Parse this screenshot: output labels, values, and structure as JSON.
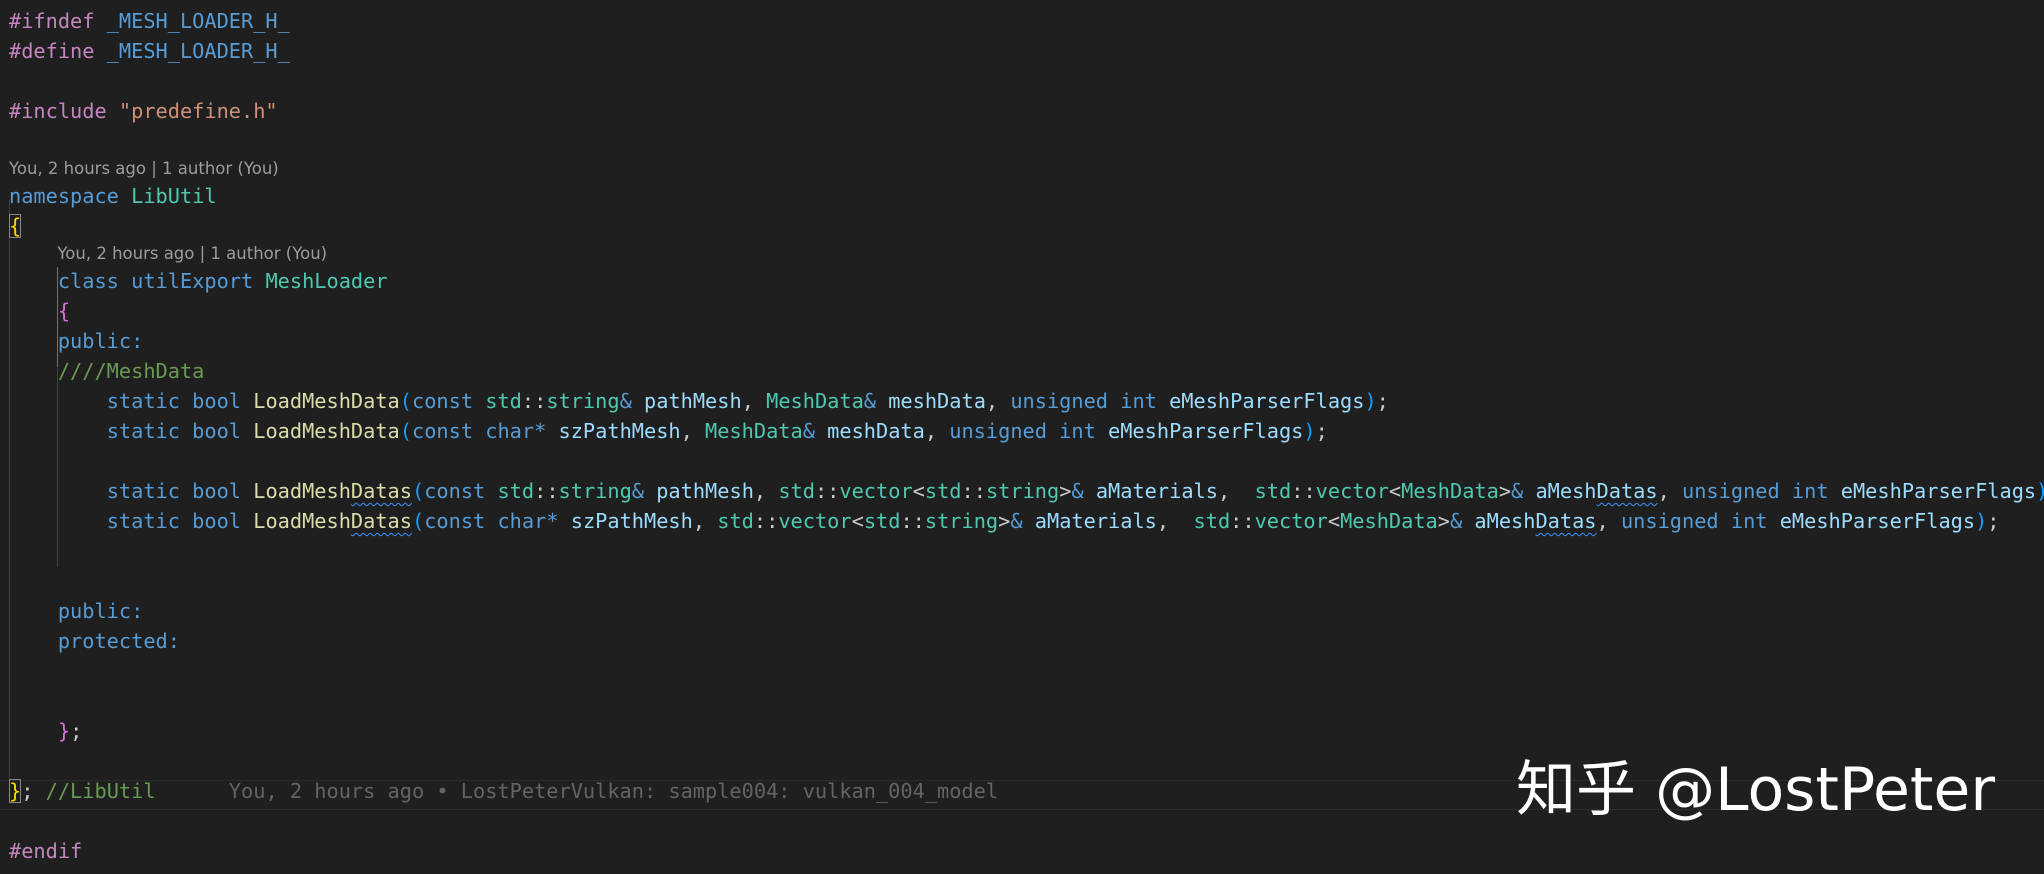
{
  "editor": {
    "theme_colors": {
      "background": "#1f1f1f",
      "preprocessor": "#c586c0",
      "keyword": "#569cd6",
      "type": "#4ec9b0",
      "function": "#dcdcaa",
      "parameter": "#9cdcfe",
      "string": "#ce9178",
      "comment": "#6a9955",
      "codelens": "#9d9d9d",
      "inline_blame": "#646464"
    },
    "lines": [
      {
        "kind": "code",
        "tokens": [
          {
            "t": "#ifndef ",
            "c": "pp"
          },
          {
            "t": "_MESH_LOADER_H_",
            "c": "macro"
          }
        ]
      },
      {
        "kind": "code",
        "tokens": [
          {
            "t": "#define ",
            "c": "pp"
          },
          {
            "t": "_MESH_LOADER_H_",
            "c": "macro"
          }
        ]
      },
      {
        "kind": "blank"
      },
      {
        "kind": "code",
        "tokens": [
          {
            "t": "#include ",
            "c": "pp"
          },
          {
            "t": "\"predefine.h\"",
            "c": "str"
          }
        ]
      },
      {
        "kind": "blank"
      },
      {
        "kind": "lens",
        "text": "You, 2 hours ago | 1 author (You)",
        "indent": 0
      },
      {
        "kind": "code",
        "tokens": [
          {
            "t": "namespace ",
            "c": "kw"
          },
          {
            "t": "LibUtil",
            "c": "type"
          }
        ]
      },
      {
        "kind": "code",
        "tokens": [
          {
            "t": "{",
            "c": "brace-y",
            "box": true
          }
        ]
      },
      {
        "kind": "lens",
        "text": "You, 2 hours ago | 1 author (You)",
        "indent": 4
      },
      {
        "kind": "code",
        "tokens": [
          {
            "t": "    "
          },
          {
            "t": "class ",
            "c": "kw"
          },
          {
            "t": "utilExport ",
            "c": "kw"
          },
          {
            "t": "MeshLoader",
            "c": "type"
          }
        ]
      },
      {
        "kind": "code",
        "tokens": [
          {
            "t": "    "
          },
          {
            "t": "{",
            "c": "brace"
          }
        ]
      },
      {
        "kind": "code",
        "tokens": [
          {
            "t": "    "
          },
          {
            "t": "public:",
            "c": "kw"
          }
        ]
      },
      {
        "kind": "code",
        "tokens": [
          {
            "t": "    "
          },
          {
            "t": "////MeshData",
            "c": "comment"
          }
        ]
      },
      {
        "kind": "code",
        "tokens": [
          {
            "t": "        "
          },
          {
            "t": "static ",
            "c": "kw"
          },
          {
            "t": "bool ",
            "c": "kw"
          },
          {
            "t": "LoadMeshData",
            "c": "fn"
          },
          {
            "t": "(",
            "c": "paren"
          },
          {
            "t": "const ",
            "c": "kw"
          },
          {
            "t": "std",
            "c": "type"
          },
          {
            "t": "::",
            "c": "punct"
          },
          {
            "t": "string",
            "c": "type"
          },
          {
            "t": "& ",
            "c": "kw"
          },
          {
            "t": "pathMesh",
            "c": "param"
          },
          {
            "t": ", ",
            "c": "punct"
          },
          {
            "t": "MeshData",
            "c": "type"
          },
          {
            "t": "& ",
            "c": "kw"
          },
          {
            "t": "meshData",
            "c": "param"
          },
          {
            "t": ", ",
            "c": "punct"
          },
          {
            "t": "unsigned ",
            "c": "kw"
          },
          {
            "t": "int ",
            "c": "kw"
          },
          {
            "t": "eMeshParserFlags",
            "c": "param"
          },
          {
            "t": ")",
            "c": "paren"
          },
          {
            "t": ";",
            "c": "punct"
          }
        ]
      },
      {
        "kind": "code",
        "tokens": [
          {
            "t": "        "
          },
          {
            "t": "static ",
            "c": "kw"
          },
          {
            "t": "bool ",
            "c": "kw"
          },
          {
            "t": "LoadMeshData",
            "c": "fn"
          },
          {
            "t": "(",
            "c": "paren"
          },
          {
            "t": "const ",
            "c": "kw"
          },
          {
            "t": "char",
            "c": "kw"
          },
          {
            "t": "* ",
            "c": "kw"
          },
          {
            "t": "szPathMesh",
            "c": "param"
          },
          {
            "t": ", ",
            "c": "punct"
          },
          {
            "t": "MeshData",
            "c": "type"
          },
          {
            "t": "& ",
            "c": "kw"
          },
          {
            "t": "meshData",
            "c": "param"
          },
          {
            "t": ", ",
            "c": "punct"
          },
          {
            "t": "unsigned ",
            "c": "kw"
          },
          {
            "t": "int ",
            "c": "kw"
          },
          {
            "t": "eMeshParserFlags",
            "c": "param"
          },
          {
            "t": ")",
            "c": "paren"
          },
          {
            "t": ";",
            "c": "punct"
          }
        ]
      },
      {
        "kind": "blank"
      },
      {
        "kind": "code",
        "tokens": [
          {
            "t": "        "
          },
          {
            "t": "static ",
            "c": "kw"
          },
          {
            "t": "bool ",
            "c": "kw"
          },
          {
            "t": "LoadMesh",
            "c": "fn"
          },
          {
            "t": "Datas",
            "c": "fn",
            "sq": true
          },
          {
            "t": "(",
            "c": "paren"
          },
          {
            "t": "const ",
            "c": "kw"
          },
          {
            "t": "std",
            "c": "type"
          },
          {
            "t": "::",
            "c": "punct"
          },
          {
            "t": "string",
            "c": "type"
          },
          {
            "t": "& ",
            "c": "kw"
          },
          {
            "t": "pathMesh",
            "c": "param"
          },
          {
            "t": ", ",
            "c": "punct"
          },
          {
            "t": "std",
            "c": "type"
          },
          {
            "t": "::",
            "c": "punct"
          },
          {
            "t": "vector",
            "c": "type"
          },
          {
            "t": "<",
            "c": "punct"
          },
          {
            "t": "std",
            "c": "type"
          },
          {
            "t": "::",
            "c": "punct"
          },
          {
            "t": "string",
            "c": "type"
          },
          {
            "t": ">",
            "c": "punct"
          },
          {
            "t": "& ",
            "c": "kw"
          },
          {
            "t": "aMaterials",
            "c": "param"
          },
          {
            "t": ",  ",
            "c": "punct"
          },
          {
            "t": "std",
            "c": "type"
          },
          {
            "t": "::",
            "c": "punct"
          },
          {
            "t": "vector",
            "c": "type"
          },
          {
            "t": "<",
            "c": "punct"
          },
          {
            "t": "MeshData",
            "c": "type"
          },
          {
            "t": ">",
            "c": "punct"
          },
          {
            "t": "& ",
            "c": "kw"
          },
          {
            "t": "aMesh",
            "c": "param"
          },
          {
            "t": "Datas",
            "c": "param",
            "sq": true
          },
          {
            "t": ", ",
            "c": "punct"
          },
          {
            "t": "unsigned ",
            "c": "kw"
          },
          {
            "t": "int ",
            "c": "kw"
          },
          {
            "t": "eMeshParserFlags",
            "c": "param"
          },
          {
            "t": ")",
            "c": "paren"
          },
          {
            "t": ";",
            "c": "punct"
          }
        ]
      },
      {
        "kind": "code",
        "tokens": [
          {
            "t": "        "
          },
          {
            "t": "static ",
            "c": "kw"
          },
          {
            "t": "bool ",
            "c": "kw"
          },
          {
            "t": "LoadMesh",
            "c": "fn"
          },
          {
            "t": "Datas",
            "c": "fn",
            "sq": true
          },
          {
            "t": "(",
            "c": "paren"
          },
          {
            "t": "const ",
            "c": "kw"
          },
          {
            "t": "char",
            "c": "kw"
          },
          {
            "t": "* ",
            "c": "kw"
          },
          {
            "t": "szPathMesh",
            "c": "param"
          },
          {
            "t": ", ",
            "c": "punct"
          },
          {
            "t": "std",
            "c": "type"
          },
          {
            "t": "::",
            "c": "punct"
          },
          {
            "t": "vector",
            "c": "type"
          },
          {
            "t": "<",
            "c": "punct"
          },
          {
            "t": "std",
            "c": "type"
          },
          {
            "t": "::",
            "c": "punct"
          },
          {
            "t": "string",
            "c": "type"
          },
          {
            "t": ">",
            "c": "punct"
          },
          {
            "t": "& ",
            "c": "kw"
          },
          {
            "t": "aMaterials",
            "c": "param"
          },
          {
            "t": ",  ",
            "c": "punct"
          },
          {
            "t": "std",
            "c": "type"
          },
          {
            "t": "::",
            "c": "punct"
          },
          {
            "t": "vector",
            "c": "type"
          },
          {
            "t": "<",
            "c": "punct"
          },
          {
            "t": "MeshData",
            "c": "type"
          },
          {
            "t": ">",
            "c": "punct"
          },
          {
            "t": "& ",
            "c": "kw"
          },
          {
            "t": "aMesh",
            "c": "param"
          },
          {
            "t": "Datas",
            "c": "param",
            "sq": true
          },
          {
            "t": ", ",
            "c": "punct"
          },
          {
            "t": "unsigned ",
            "c": "kw"
          },
          {
            "t": "int ",
            "c": "kw"
          },
          {
            "t": "eMeshParserFlags",
            "c": "param"
          },
          {
            "t": ")",
            "c": "paren"
          },
          {
            "t": ";",
            "c": "punct"
          }
        ]
      },
      {
        "kind": "blank"
      },
      {
        "kind": "blank"
      },
      {
        "kind": "code",
        "tokens": [
          {
            "t": "    "
          },
          {
            "t": "public:",
            "c": "kw"
          }
        ]
      },
      {
        "kind": "code",
        "tokens": [
          {
            "t": "    "
          },
          {
            "t": "protected:",
            "c": "kw"
          }
        ]
      },
      {
        "kind": "blank"
      },
      {
        "kind": "blank"
      },
      {
        "kind": "code",
        "tokens": [
          {
            "t": "    "
          },
          {
            "t": "}",
            "c": "brace"
          },
          {
            "t": ";",
            "c": "punct"
          }
        ]
      },
      {
        "kind": "blank"
      },
      {
        "kind": "code",
        "current": true,
        "tokens": [
          {
            "t": "}",
            "c": "brace-y",
            "box": true
          },
          {
            "t": "; ",
            "c": "punct"
          },
          {
            "t": "//LibUtil",
            "c": "comment"
          },
          {
            "t": "      You, 2 hours ago • LostPeterVulkan: sample004: vulkan_004_model",
            "c": "blame"
          }
        ]
      },
      {
        "kind": "blank"
      },
      {
        "kind": "code",
        "tokens": [
          {
            "t": "#endif",
            "c": "pp"
          }
        ]
      }
    ]
  },
  "watermark": {
    "text": "知乎 @LostPeter"
  }
}
